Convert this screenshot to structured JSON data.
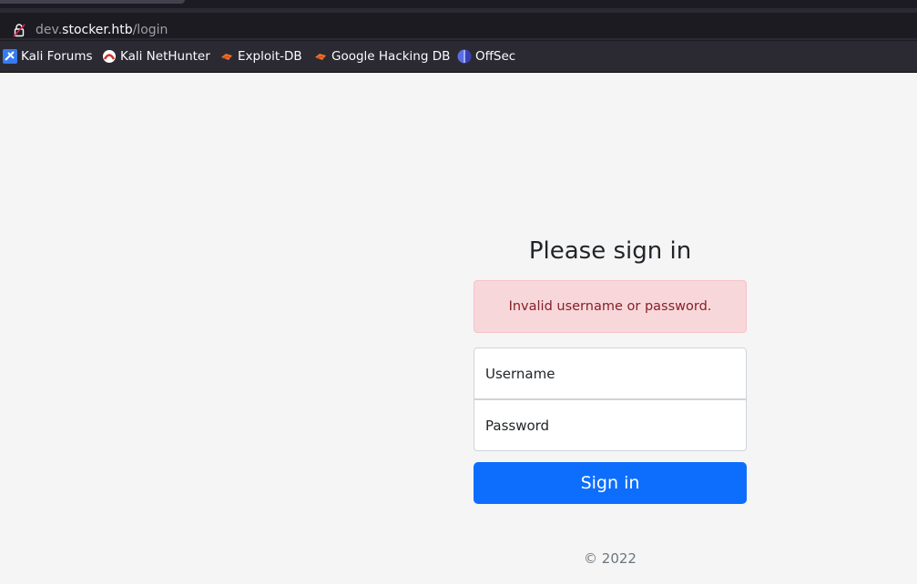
{
  "browser": {
    "url": {
      "prefix": "dev.",
      "domain": "stocker.htb",
      "path": "/login"
    },
    "bookmarks": [
      {
        "label": "Kali Forums",
        "icon": "kali-forums-icon"
      },
      {
        "label": "Kali NetHunter",
        "icon": "kali-nethunter-icon"
      },
      {
        "label": "Exploit-DB",
        "icon": "exploit-db-icon"
      },
      {
        "label": "Google Hacking DB",
        "icon": "google-hacking-db-icon"
      },
      {
        "label": "OffSec",
        "icon": "offsec-icon"
      }
    ]
  },
  "login": {
    "title": "Please sign in",
    "error": "Invalid username or password.",
    "username_placeholder": "Username",
    "password_placeholder": "Password",
    "submit_label": "Sign in",
    "footer": "© 2022"
  },
  "colors": {
    "primary": "#0d6efd",
    "alert_bg": "#f8d7da",
    "alert_text": "#842029",
    "page_bg": "#f5f5f5"
  }
}
